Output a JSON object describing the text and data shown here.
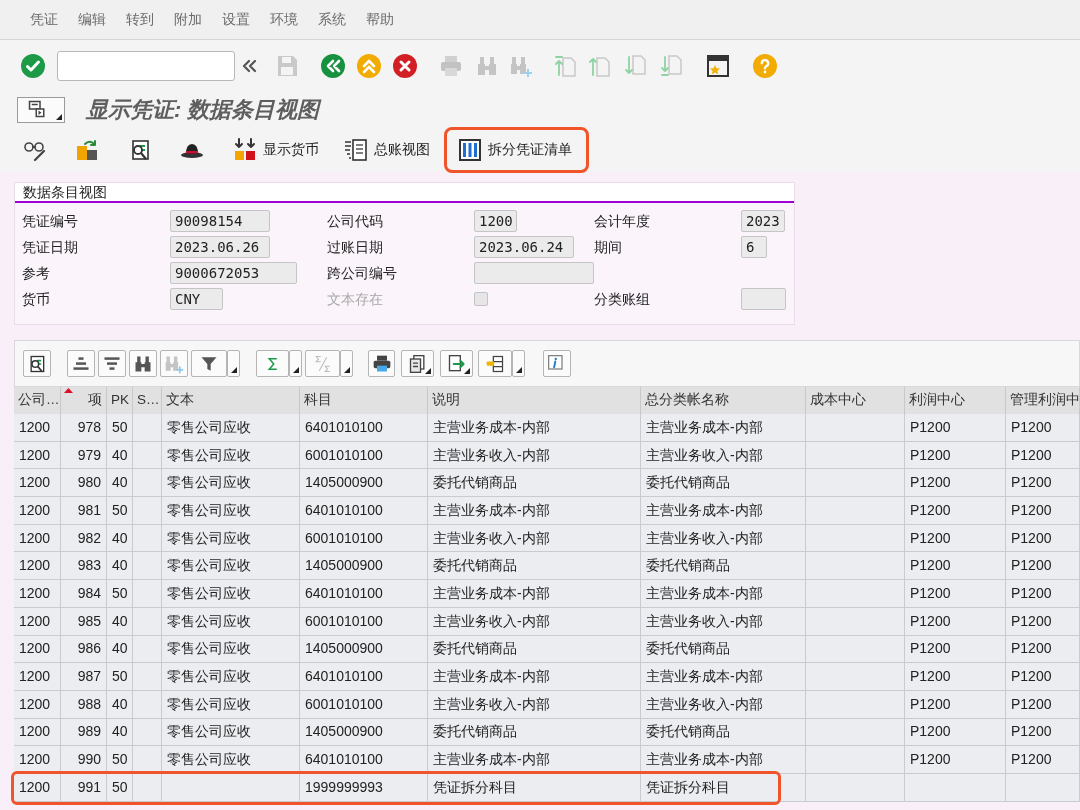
{
  "menu_bar": [
    "凭证",
    "编辑",
    "转到",
    "附加",
    "设置",
    "环境",
    "系统",
    "帮助"
  ],
  "title": "显示凭证: 数据条目视图",
  "app_toolbar": [
    {
      "label": "显示货币",
      "highlighted": false
    },
    {
      "label": "总账视图",
      "highlighted": false
    },
    {
      "label": "拆分凭证清单",
      "highlighted": true
    }
  ],
  "header": {
    "title": "数据条目视图",
    "rows": [
      [
        {
          "kind": "text",
          "label": "凭证编号",
          "value": "90098154",
          "disabled": false
        },
        {
          "kind": "text",
          "label": "公司代码",
          "value": "1200",
          "disabled": false
        },
        {
          "kind": "text",
          "label": "会计年度",
          "value": "2023",
          "disabled": false
        }
      ],
      [
        {
          "kind": "text",
          "label": "凭证日期",
          "value": "2023.06.26",
          "disabled": false
        },
        {
          "kind": "text",
          "label": "过账日期",
          "value": "2023.06.24",
          "disabled": false
        },
        {
          "kind": "text",
          "label": "期间",
          "value": "6",
          "disabled": false
        }
      ],
      [
        {
          "kind": "text",
          "label": "参考",
          "value": "9000672053",
          "disabled": false
        },
        {
          "kind": "text",
          "label": "跨公司编号",
          "disabled": false
        }
      ],
      [
        {
          "kind": "text",
          "label": "货币",
          "value": "CNY",
          "disabled": false
        },
        {
          "kind": "checkbox",
          "label": "文本存在",
          "checked": false,
          "disabled": true
        },
        {
          "kind": "text",
          "label": "分类账组",
          "disabled": false
        }
      ]
    ]
  },
  "table": {
    "columns": [
      {
        "label": "公司…",
        "sorted": false
      },
      {
        "label": "项",
        "sorted": true
      },
      {
        "label": "PK",
        "sorted": false
      },
      {
        "label": "S…",
        "sorted": false
      },
      {
        "label": "文本",
        "sorted": false
      },
      {
        "label": "科目",
        "sorted": false
      },
      {
        "label": "说明",
        "sorted": false
      },
      {
        "label": "总分类帐名称",
        "sorted": false
      },
      {
        "label": "成本中心",
        "sorted": false
      },
      {
        "label": "利润中心",
        "sorted": false
      },
      {
        "label": "管理利润中",
        "sorted": false
      }
    ],
    "rows": [
      {
        "company_code": "1200",
        "item": "978",
        "pk": "50",
        "text": "零售公司应收",
        "account": "6401010100",
        "description": "主营业务成本-内部",
        "gl_account_name": "主营业务成本-内部",
        "profit_center": "P1200",
        "mgmt_profit_center": "P1200",
        "highlighted": false
      },
      {
        "company_code": "1200",
        "item": "979",
        "pk": "40",
        "text": "零售公司应收",
        "account": "6001010100",
        "description": "主营业务收入-内部",
        "gl_account_name": "主营业务收入-内部",
        "profit_center": "P1200",
        "mgmt_profit_center": "P1200",
        "highlighted": false
      },
      {
        "company_code": "1200",
        "item": "980",
        "pk": "40",
        "text": "零售公司应收",
        "account": "1405000900",
        "description": "委托代销商品",
        "gl_account_name": "委托代销商品",
        "profit_center": "P1200",
        "mgmt_profit_center": "P1200",
        "highlighted": false
      },
      {
        "company_code": "1200",
        "item": "981",
        "pk": "50",
        "text": "零售公司应收",
        "account": "6401010100",
        "description": "主营业务成本-内部",
        "gl_account_name": "主营业务成本-内部",
        "profit_center": "P1200",
        "mgmt_profit_center": "P1200",
        "highlighted": false
      },
      {
        "company_code": "1200",
        "item": "982",
        "pk": "40",
        "text": "零售公司应收",
        "account": "6001010100",
        "description": "主营业务收入-内部",
        "gl_account_name": "主营业务收入-内部",
        "profit_center": "P1200",
        "mgmt_profit_center": "P1200",
        "highlighted": false
      },
      {
        "company_code": "1200",
        "item": "983",
        "pk": "40",
        "text": "零售公司应收",
        "account": "1405000900",
        "description": "委托代销商品",
        "gl_account_name": "委托代销商品",
        "profit_center": "P1200",
        "mgmt_profit_center": "P1200",
        "highlighted": false
      },
      {
        "company_code": "1200",
        "item": "984",
        "pk": "50",
        "text": "零售公司应收",
        "account": "6401010100",
        "description": "主营业务成本-内部",
        "gl_account_name": "主营业务成本-内部",
        "profit_center": "P1200",
        "mgmt_profit_center": "P1200",
        "highlighted": false
      },
      {
        "company_code": "1200",
        "item": "985",
        "pk": "40",
        "text": "零售公司应收",
        "account": "6001010100",
        "description": "主营业务收入-内部",
        "gl_account_name": "主营业务收入-内部",
        "profit_center": "P1200",
        "mgmt_profit_center": "P1200",
        "highlighted": false
      },
      {
        "company_code": "1200",
        "item": "986",
        "pk": "40",
        "text": "零售公司应收",
        "account": "1405000900",
        "description": "委托代销商品",
        "gl_account_name": "委托代销商品",
        "profit_center": "P1200",
        "mgmt_profit_center": "P1200",
        "highlighted": false
      },
      {
        "company_code": "1200",
        "item": "987",
        "pk": "50",
        "text": "零售公司应收",
        "account": "6401010100",
        "description": "主营业务成本-内部",
        "gl_account_name": "主营业务成本-内部",
        "profit_center": "P1200",
        "mgmt_profit_center": "P1200",
        "highlighted": false
      },
      {
        "company_code": "1200",
        "item": "988",
        "pk": "40",
        "text": "零售公司应收",
        "account": "6001010100",
        "description": "主营业务收入-内部",
        "gl_account_name": "主营业务收入-内部",
        "profit_center": "P1200",
        "mgmt_profit_center": "P1200",
        "highlighted": false
      },
      {
        "company_code": "1200",
        "item": "989",
        "pk": "40",
        "text": "零售公司应收",
        "account": "1405000900",
        "description": "委托代销商品",
        "gl_account_name": "委托代销商品",
        "profit_center": "P1200",
        "mgmt_profit_center": "P1200",
        "highlighted": false
      },
      {
        "company_code": "1200",
        "item": "990",
        "pk": "50",
        "text": "零售公司应收",
        "account": "6401010100",
        "description": "主营业务成本-内部",
        "gl_account_name": "主营业务成本-内部",
        "profit_center": "P1200",
        "mgmt_profit_center": "P1200",
        "highlighted": false
      },
      {
        "company_code": "1200",
        "item": "991",
        "pk": "50",
        "account": "1999999993",
        "description": "凭证拆分科目",
        "gl_account_name": "凭证拆分科目",
        "highlighted": true
      }
    ]
  }
}
